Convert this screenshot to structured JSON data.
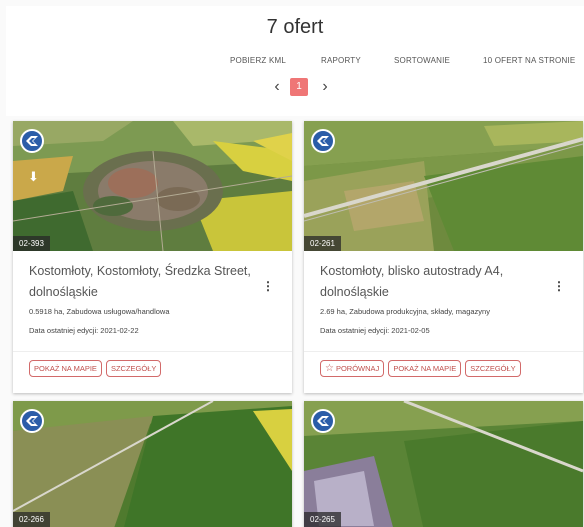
{
  "header": {
    "title": "7 ofert",
    "toolbar": {
      "kml": "POBIERZ KML",
      "raporty": "RAPORTY",
      "sort": "SORTOWANIE",
      "per_page": "10 OFERT NA STRONIE"
    },
    "pager": {
      "prev": "‹",
      "current": "1",
      "next": "›"
    }
  },
  "listings": [
    {
      "code": "02-393",
      "title": "Kostomłoty, Kostomłoty, Średzka Street, dolnośląskie",
      "meta": "0.5918 ha, Zabudowa usługowa/handlowa",
      "date": "Data ostatniej edycji: 2021-02-22",
      "actions": {
        "compare": null,
        "map": "POKAŻ NA MAPIE",
        "details": "SZCZEGÓŁY"
      }
    },
    {
      "code": "02-261",
      "title": "Kostomłoty, blisko autostrady A4, dolnośląskie",
      "meta": "2.69 ha, Zabudowa produkcyjna, składy, magazyny",
      "date": "Data ostatniej edycji: 2021-02-05",
      "actions": {
        "compare": "PORÓWNAJ",
        "map": "POKAŻ NA MAPIE",
        "details": "SZCZEGÓŁY"
      }
    },
    {
      "code": "02-266"
    },
    {
      "code": "02-265"
    }
  ],
  "icons": {
    "logo": "agency-logo-icon",
    "menu": "more-vert-icon",
    "compare": "star-outline-icon"
  },
  "colors": {
    "accent": "#c0504d",
    "pager_active": "#ef7676",
    "logo_bg": "#2b5da8"
  }
}
